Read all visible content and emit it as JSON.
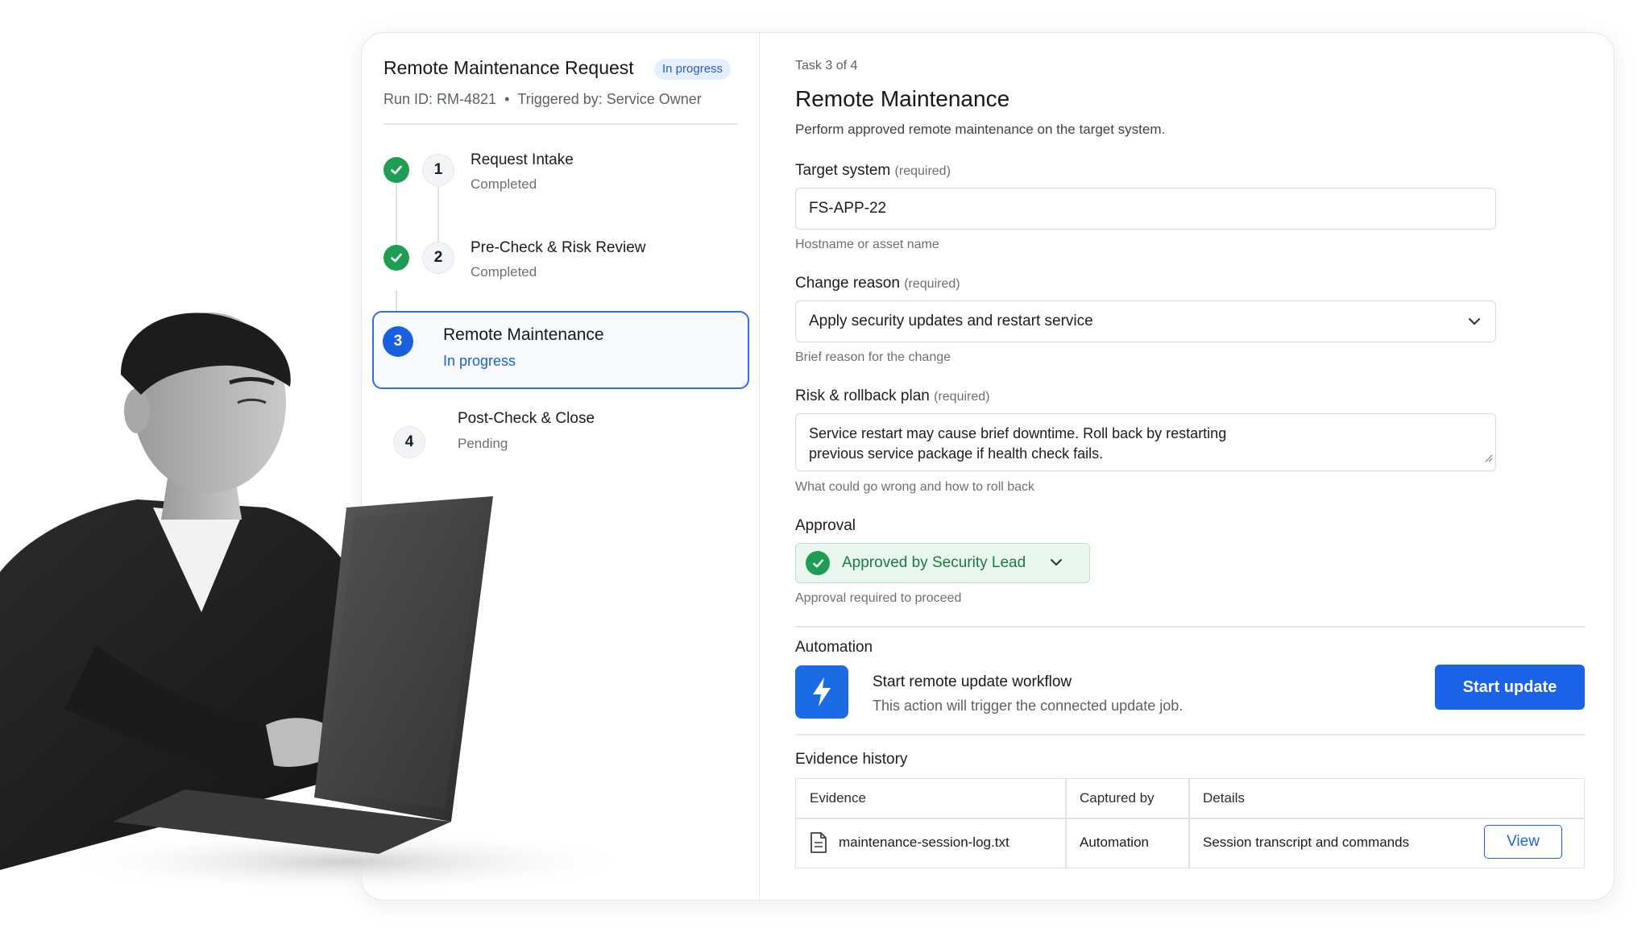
{
  "request": {
    "title": "Remote Maintenance Request",
    "status_badge": "In progress",
    "run_id": "Run ID: RM-4821",
    "separator": "•",
    "triggered_by": "Triggered by: Service Owner"
  },
  "steps": [
    {
      "number": "1",
      "title": "Request Intake",
      "status": "Completed"
    },
    {
      "number": "2",
      "title": "Pre-Check & Risk Review",
      "status": "Completed"
    },
    {
      "number": "3",
      "title": "Remote Maintenance",
      "status": "In progress"
    },
    {
      "number": "4",
      "title": "Post-Check & Close",
      "status": "Pending"
    }
  ],
  "task": {
    "counter": "Task 3 of 4",
    "title": "Remote Maintenance",
    "description": "Perform approved remote maintenance on the target system."
  },
  "form": {
    "target_system": {
      "label": "Target system",
      "required": "(required)",
      "value": "FS-APP-22",
      "help": "Hostname or asset name"
    },
    "change_reason": {
      "label": "Change reason",
      "required": "(required)",
      "value": "Apply security updates and restart service",
      "help": "Brief reason for the change"
    },
    "risk_plan": {
      "label": "Risk & rollback plan",
      "required": "(required)",
      "value": "Service restart may cause brief downtime. Roll back by restarting previous service package if health check fails.",
      "help": "What could go wrong and how to roll back"
    },
    "approval": {
      "label": "Approval",
      "value": "Approved by Security Lead",
      "help": "Approval required to proceed"
    }
  },
  "automation": {
    "label": "Automation",
    "title": "Start remote update workflow",
    "description": "This action will trigger the connected update job.",
    "button": "Start update"
  },
  "evidence": {
    "label": "Evidence history",
    "columns": [
      "Evidence",
      "Captured by",
      "Details"
    ],
    "rows": [
      {
        "file": "maintenance-session-log.txt",
        "captured_by": "Automation",
        "details": "Session transcript and commands",
        "action": "View"
      }
    ]
  },
  "colors": {
    "accent": "#1a62e8",
    "success": "#1f9d55",
    "badge_bg": "#e6efff"
  }
}
